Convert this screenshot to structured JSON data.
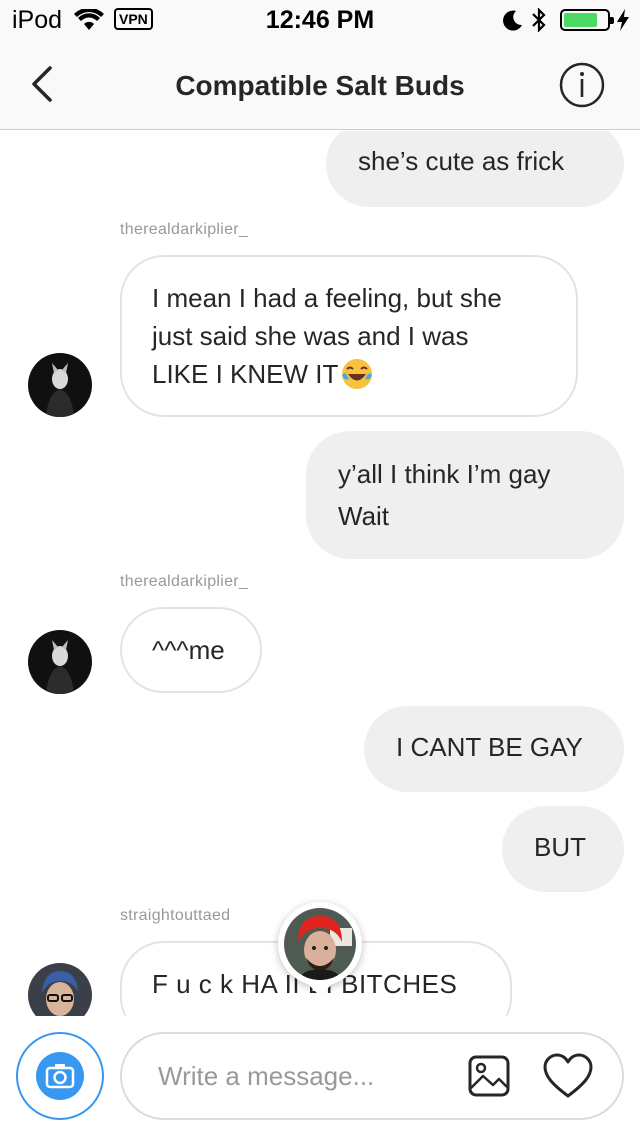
{
  "status_bar": {
    "carrier": "iPod",
    "vpn": "VPN",
    "time": "12:46 PM",
    "battery_level": 0.8,
    "icons": [
      "wifi-icon",
      "moon-icon",
      "bluetooth-icon",
      "battery-icon",
      "charging-bolt-icon"
    ]
  },
  "header": {
    "title": "Compatible Salt Buds",
    "back_icon": "chevron-left-icon",
    "info_icon": "info-icon"
  },
  "messages": [
    {
      "direction": "out",
      "text": "she’s cute as frick"
    },
    {
      "direction": "in",
      "sender": "therealdarkiplier_",
      "lines": [
        "I mean I had a feeling, but she",
        "just said she was and I was",
        "LIKE I KNEW IT"
      ],
      "emoji": "face-with-tears-of-joy"
    },
    {
      "direction": "out",
      "lines": [
        "y’all I think I’m gay",
        "Wait"
      ]
    },
    {
      "direction": "in",
      "sender": "therealdarkiplier_",
      "text": "^^^me"
    },
    {
      "direction": "out",
      "text": "I CANT BE GAY"
    },
    {
      "direction": "out",
      "text": "BUT"
    },
    {
      "direction": "in",
      "sender": "straightouttaed",
      "text": "F u c k HA I​I BI BITCHES"
    }
  ],
  "composer": {
    "placeholder": "Write a message...",
    "value": ""
  },
  "colors": {
    "accent": "#3897f0",
    "outgoing_bubble": "#efefef",
    "incoming_border": "#e3e3e3",
    "battery_fill": "#4cd964"
  }
}
